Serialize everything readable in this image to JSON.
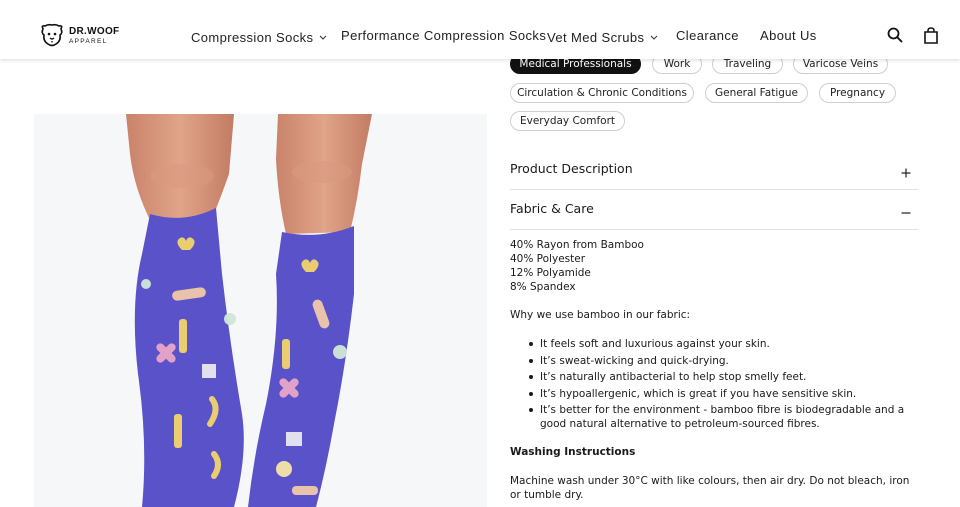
{
  "brand": {
    "name_line1": "DR.WOOF",
    "name_line2": "APPAREL"
  },
  "nav": {
    "items": [
      {
        "label": "Compression Socks",
        "has_dropdown": true
      },
      {
        "label": "Performance Compression Socks",
        "has_dropdown": false
      },
      {
        "label": "Vet Med Scrubs",
        "has_dropdown": true
      },
      {
        "label": "Clearance",
        "has_dropdown": false
      },
      {
        "label": "About Us",
        "has_dropdown": false
      }
    ],
    "icons": [
      "search-icon",
      "shopping-bag-icon"
    ]
  },
  "tags": [
    {
      "label": "Medical Professionals",
      "active": true
    },
    {
      "label": "Work",
      "active": false
    },
    {
      "label": "Traveling",
      "active": false
    },
    {
      "label": "Varicose Veins",
      "active": false
    },
    {
      "label": "Circulation & Chronic Conditions",
      "active": false
    },
    {
      "label": "General Fatigue",
      "active": false
    },
    {
      "label": "Pregnancy",
      "active": false
    },
    {
      "label": "Everyday Comfort",
      "active": false
    }
  ],
  "accordion": {
    "description": {
      "title": "Product Description",
      "expanded": false
    },
    "fabric": {
      "title": "Fabric & Care",
      "expanded": true,
      "composition": [
        "40% Rayon from Bamboo",
        "40% Polyester",
        "12% Polyamide",
        "8% Spandex"
      ],
      "why_heading": "Why we use bamboo in our fabric:",
      "benefits": [
        "It feels soft and luxurious against your skin.",
        "It’s sweat-wicking and quick-drying.",
        "It’s naturally antibacterial to help stop smelly feet.",
        "It’s hypoallergenic, which is great if you have sensitive skin.",
        "It’s better for the environment - bamboo fibre is biodegradable and a good natural alternative to petroleum-sourced fibres."
      ],
      "washing_heading": "Washing Instructions",
      "washing_text": "Machine wash under 30°C with like colours, then air dry. Do not bleach, iron or tumble dry."
    }
  },
  "colors": {
    "accent": "#111111",
    "sock_blue": "#5a52c8",
    "divider": "#e2e2e2"
  }
}
